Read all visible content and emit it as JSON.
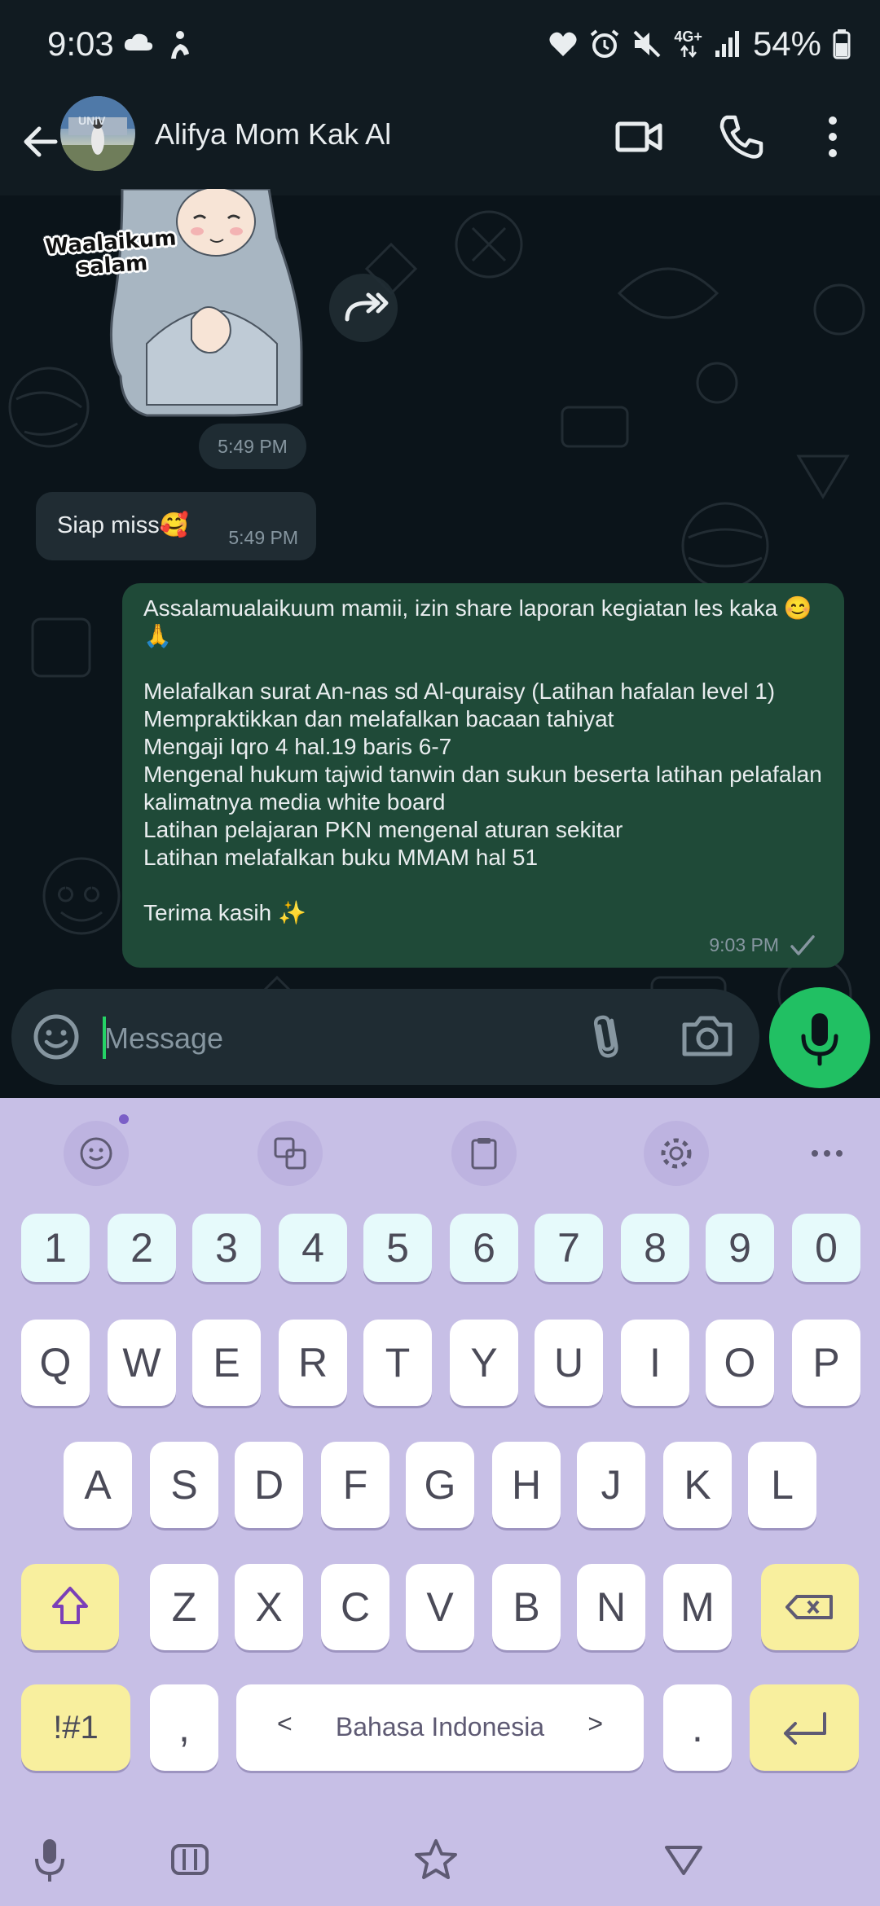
{
  "status_bar": {
    "time": "9:03",
    "network": "4G+",
    "battery": "54%"
  },
  "header": {
    "contact_name": "Alifya Mom Kak Al",
    "avatar_text": "UNIV"
  },
  "messages": {
    "sticker": {
      "text_line1": "Waalaikum",
      "text_line2": "salam",
      "time": "5:49 PM"
    },
    "incoming": {
      "text": "Siap miss🥰",
      "time": "5:49 PM"
    },
    "outgoing": {
      "text": "Assalamualaikuum mamii, izin share laporan kegiatan les kaka 😊🙏\n\nMelafalkan surat An-nas sd Al-quraisy (Latihan hafalan level 1)\nMempraktikkan dan melafalkan bacaan tahiyat\nMengaji Iqro 4 hal.19 baris 6-7\nMengenal hukum tajwid tanwin dan sukun beserta latihan pelafalan kalimatnya media white board\nLatihan pelajaran PKN mengenal aturan sekitar\nLatihan melafalkan buku MMAM hal 51\n\nTerima kasih ✨",
      "time": "9:03 PM"
    }
  },
  "composer": {
    "placeholder": "Message"
  },
  "keyboard": {
    "number_row": [
      "1",
      "2",
      "3",
      "4",
      "5",
      "6",
      "7",
      "8",
      "9",
      "0"
    ],
    "row1": [
      "Q",
      "W",
      "E",
      "R",
      "T",
      "Y",
      "U",
      "I",
      "O",
      "P"
    ],
    "row2": [
      "A",
      "S",
      "D",
      "F",
      "G",
      "H",
      "J",
      "K",
      "L"
    ],
    "row3": [
      "Z",
      "X",
      "C",
      "V",
      "B",
      "N",
      "M"
    ],
    "symbols_key": "!#1",
    "comma_key": ",",
    "period_key": ".",
    "space_label": "Bahasa Indonesia",
    "space_left_arrow": "<",
    "space_right_arrow": ">"
  },
  "colors": {
    "chat_bg": "#0b141a",
    "outgoing_bubble": "#1f4a38",
    "incoming_bubble": "#202c33",
    "accent_green": "#21c063",
    "keyboard_bg": "#c7bfe6"
  }
}
